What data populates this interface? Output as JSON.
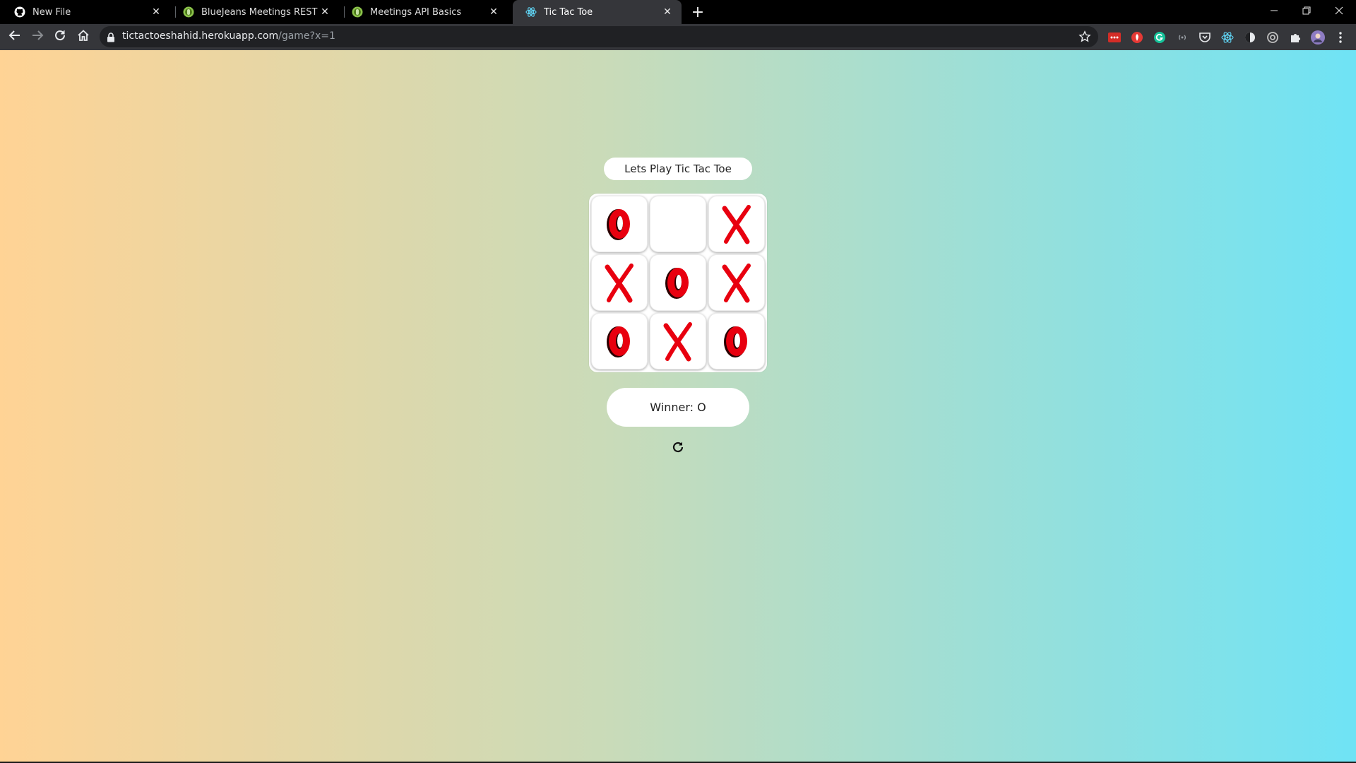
{
  "browser": {
    "tabs": [
      {
        "title": "New File",
        "favicon": "github-icon",
        "active": false
      },
      {
        "title": "BlueJeans Meetings REST API's",
        "favicon": "bluejeans-icon",
        "active": false
      },
      {
        "title": "Meetings API Basics",
        "favicon": "bluejeans-icon",
        "active": false
      },
      {
        "title": "Tic Tac Toe",
        "favicon": "react-icon",
        "active": true
      }
    ],
    "url_host": "tictactoeshahid.herokuapp.com",
    "url_path": "/game?x=1"
  },
  "game": {
    "title": "Lets Play Tic Tac Toe",
    "board": [
      "O",
      "",
      "X",
      "X",
      "O",
      "X",
      "O",
      "X",
      "O"
    ],
    "winner_text": "Winner: O"
  },
  "colors": {
    "mark": "#e8000f",
    "mark_shadow": "#2a0000",
    "gradient_left": "#ffd395",
    "gradient_right": "#6fe3f5"
  }
}
